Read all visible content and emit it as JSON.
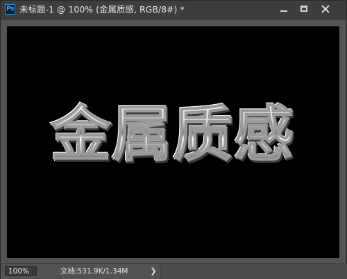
{
  "window": {
    "app_icon_text": "Ps",
    "title": "未标题-1 @ 100% (金属质感, RGB/8#) *"
  },
  "window_controls": {
    "minimize": "minimize-icon",
    "maximize": "maximize-icon",
    "close": "close-icon"
  },
  "canvas": {
    "background": "#000000",
    "text": "金属质感"
  },
  "statusbar": {
    "zoom": "100%",
    "doc_info": "文档:531.9K/1.34M",
    "arrow": "❯"
  }
}
